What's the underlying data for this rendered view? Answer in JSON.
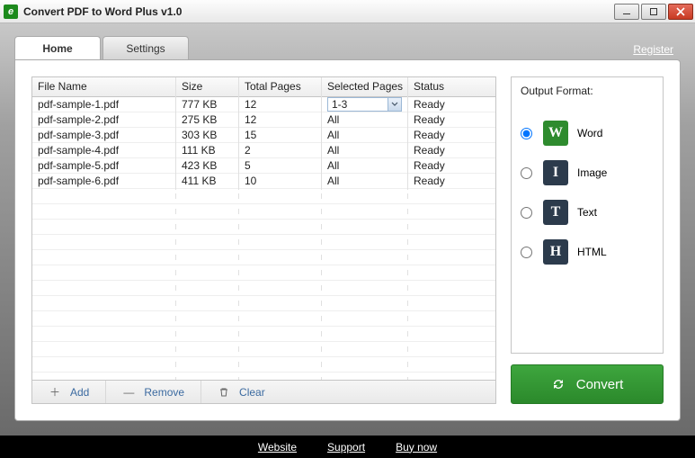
{
  "window": {
    "title": "Convert PDF to Word Plus v1.0"
  },
  "links": {
    "register": "Register"
  },
  "tabs": {
    "home": "Home",
    "settings": "Settings"
  },
  "columns": {
    "name": "File Name",
    "size": "Size",
    "pages": "Total Pages",
    "selected": "Selected Pages",
    "status": "Status"
  },
  "rows": [
    {
      "name": "pdf-sample-1.pdf",
      "size": "777 KB",
      "pages": "12",
      "selected": "1-3",
      "status": "Ready",
      "editing": true
    },
    {
      "name": "pdf-sample-2.pdf",
      "size": "275 KB",
      "pages": "12",
      "selected": "All",
      "status": "Ready"
    },
    {
      "name": "pdf-sample-3.pdf",
      "size": "303 KB",
      "pages": "15",
      "selected": "All",
      "status": "Ready"
    },
    {
      "name": "pdf-sample-4.pdf",
      "size": "111 KB",
      "pages": "2",
      "selected": "All",
      "status": "Ready"
    },
    {
      "name": "pdf-sample-5.pdf",
      "size": "423 KB",
      "pages": "5",
      "selected": "All",
      "status": "Ready"
    },
    {
      "name": "pdf-sample-6.pdf",
      "size": "411 KB",
      "pages": "10",
      "selected": "All",
      "status": "Ready"
    }
  ],
  "toolbar": {
    "add": "Add",
    "remove": "Remove",
    "clear": "Clear"
  },
  "format": {
    "title": "Output Format:",
    "options": {
      "word": "Word",
      "image": "Image",
      "text": "Text",
      "html": "HTML"
    },
    "selected": "word"
  },
  "convert": "Convert",
  "footer": {
    "website": "Website",
    "support": "Support",
    "buy": "Buy now"
  }
}
